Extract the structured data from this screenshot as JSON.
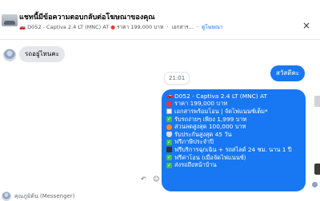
{
  "header": {
    "title": "แชทนี้มีข้อความตอบกลับต่อโฆษณาของคุณ",
    "listing_code": "D052 - Captiva 2.4 LT (MNC) AT",
    "listing_price": "ราคา 199,000 บาท",
    "listing_more": "เอกสาร...",
    "view_ad_link": "ดูโฆษณา",
    "close_glyph": "×"
  },
  "conversation": {
    "incoming_message": "รถอยู่ไหนคะ",
    "timestamp": "21:01",
    "outgoing_greeting": "สวัสดีคะ",
    "outgoing_lines": [
      {
        "icon": "car-icon",
        "text": "D052 - Captiva 2.4 LT (MNC) AT"
      },
      {
        "icon": "red-circle-icon",
        "text": "ราคา 199,000 บาท"
      },
      {
        "icon": "document-icon",
        "text": "เอกสารพร้อมโอน | จัดไฟแนนซ์เต็ม*"
      },
      {
        "icon": "check-icon",
        "text": "รับรถง่ายๆ เพียง 1,999 บาท"
      },
      {
        "icon": "orange-circle-icon",
        "text": "ส่วนลดสูงสุด 100,000 บาท"
      },
      {
        "icon": "shield-icon",
        "text": "รับประกันสูงสุด 45 วัน"
      },
      {
        "icon": "check-icon",
        "text": "ฟรีภาษีประจำปี"
      },
      {
        "icon": "phone-icon",
        "text": "ฟรีบริการฉุกเฉิน + รถสไลด์ 24 ชม. นาน 1 ปี"
      },
      {
        "icon": "check-icon",
        "text": "ฟรีค่าโอน (เมื่อจัดไฟแนนซ์)"
      },
      {
        "icon": "check-icon",
        "text": "ส่งรถถึงหน้าบ้าน"
      }
    ],
    "reply_tools": "↶ ☺ ⋮"
  },
  "footer": {
    "partial_name": "คุณภูมิต้น (Messenger)"
  },
  "colors": {
    "accent": "#1877f2",
    "incoming_bg": "#e4e6eb"
  }
}
